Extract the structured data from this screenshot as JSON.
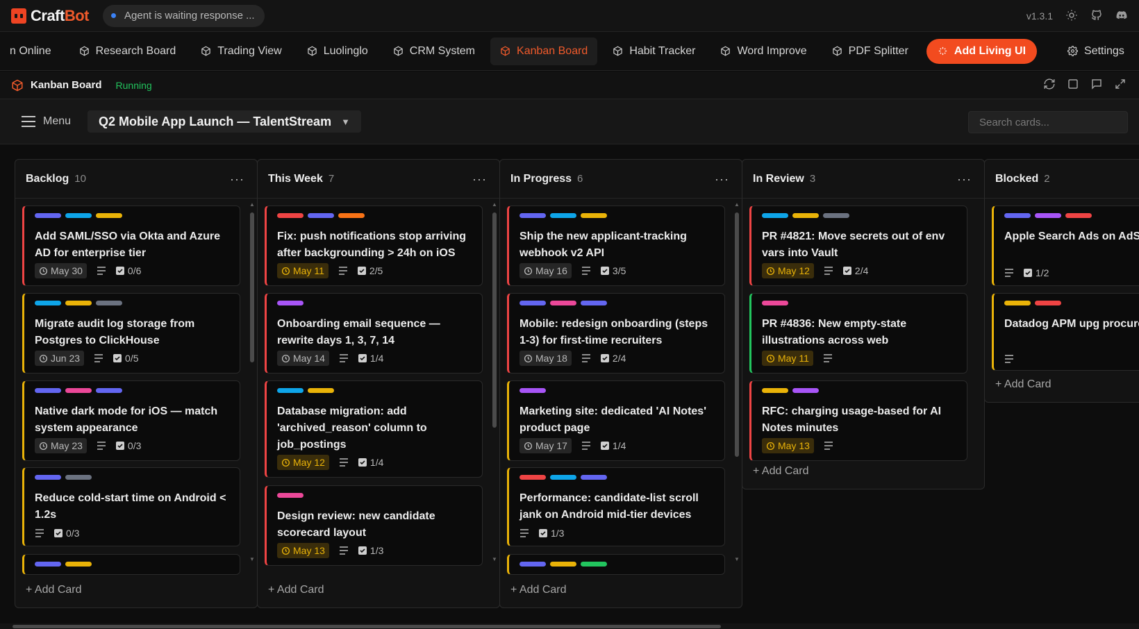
{
  "app": {
    "brand_craft": "Craft",
    "brand_bot": "Bot",
    "agent_status": "Agent is waiting response ...",
    "version": "v1.3.1"
  },
  "nav": {
    "items": [
      {
        "label": "n Online",
        "active": false,
        "icon": false
      },
      {
        "label": "Research Board",
        "active": false,
        "icon": true
      },
      {
        "label": "Trading View",
        "active": false,
        "icon": true
      },
      {
        "label": "Luolinglo",
        "active": false,
        "icon": true
      },
      {
        "label": "CRM System",
        "active": false,
        "icon": true
      },
      {
        "label": "Kanban Board",
        "active": true,
        "icon": true
      },
      {
        "label": "Habit Tracker",
        "active": false,
        "icon": true
      },
      {
        "label": "Word Improve",
        "active": false,
        "icon": true
      },
      {
        "label": "PDF Splitter",
        "active": false,
        "icon": true
      }
    ],
    "add_label": "Add Living UI",
    "settings_label": "Settings"
  },
  "appbar": {
    "title": "Kanban Board",
    "status": "Running"
  },
  "toolbar": {
    "menu_label": "Menu",
    "board_name": "Q2 Mobile App Launch — TalentStream",
    "search_placeholder": "Search cards..."
  },
  "add_card_label": "+ Add Card",
  "colors": {
    "brand": "#f05a2b",
    "tags": {
      "blue": "#3b82f6",
      "cyan": "#0ea5e9",
      "yellow": "#eab308",
      "gray": "#6b7280",
      "pink": "#ec4899",
      "indigo": "#6366f1",
      "red": "#ef4444",
      "orange": "#f97316",
      "purple": "#a855f7",
      "green": "#22c55e"
    }
  },
  "columns": [
    {
      "title": "Backlog",
      "count": "10",
      "cards": [
        {
          "tags": [
            "indigo",
            "cyan",
            "yellow"
          ],
          "title": "Add SAML/SSO via Okta and Azure AD for enterprise tier",
          "due": "May 30",
          "due_soon": false,
          "desc": true,
          "checklist": "0/6",
          "prio": "high"
        },
        {
          "tags": [
            "cyan",
            "yellow",
            "gray"
          ],
          "title": "Migrate audit log storage from Postgres to ClickHouse",
          "due": "Jun 23",
          "due_soon": false,
          "desc": true,
          "checklist": "0/5",
          "prio": "med"
        },
        {
          "tags": [
            "indigo",
            "pink",
            "indigo"
          ],
          "title": "Native dark mode for iOS — match system appearance",
          "due": "May 23",
          "due_soon": false,
          "desc": true,
          "checklist": "0/3",
          "prio": "med"
        },
        {
          "tags": [
            "indigo",
            "gray"
          ],
          "title": "Reduce cold-start time on Android < 1.2s",
          "due": "",
          "due_soon": false,
          "desc": true,
          "checklist": "0/3",
          "prio": "med"
        },
        {
          "tags": [
            "indigo",
            "yellow"
          ],
          "title": "",
          "due": "",
          "due_soon": false,
          "desc": false,
          "checklist": "",
          "prio": "med"
        }
      ]
    },
    {
      "title": "This Week",
      "count": "7",
      "cards": [
        {
          "tags": [
            "red",
            "indigo",
            "orange"
          ],
          "title": "Fix: push notifications stop arriving after backgrounding > 24h on iOS",
          "due": "May 11",
          "due_soon": true,
          "desc": true,
          "checklist": "2/5",
          "prio": "high"
        },
        {
          "tags": [
            "purple"
          ],
          "title": "Onboarding email sequence — rewrite days 1, 3, 7, 14",
          "due": "May 14",
          "due_soon": false,
          "desc": true,
          "checklist": "1/4",
          "prio": "high"
        },
        {
          "tags": [
            "cyan",
            "yellow"
          ],
          "title": "Database migration: add 'archived_reason' column to job_postings",
          "due": "May 12",
          "due_soon": true,
          "desc": true,
          "checklist": "1/4",
          "prio": "high"
        },
        {
          "tags": [
            "pink"
          ],
          "title": "Design review: new candidate scorecard layout",
          "due": "May 13",
          "due_soon": true,
          "desc": true,
          "checklist": "1/3",
          "prio": "high"
        }
      ]
    },
    {
      "title": "In Progress",
      "count": "6",
      "cards": [
        {
          "tags": [
            "indigo",
            "cyan",
            "yellow"
          ],
          "title": "Ship the new applicant-tracking webhook v2 API",
          "due": "May 16",
          "due_soon": false,
          "desc": true,
          "checklist": "3/5",
          "prio": "high"
        },
        {
          "tags": [
            "indigo",
            "pink",
            "indigo"
          ],
          "title": "Mobile: redesign onboarding (steps 1-3) for first-time recruiters",
          "due": "May 18",
          "due_soon": false,
          "desc": true,
          "checklist": "2/4",
          "prio": "high"
        },
        {
          "tags": [
            "purple"
          ],
          "title": "Marketing site: dedicated 'AI Notes' product page",
          "due": "May 17",
          "due_soon": false,
          "desc": true,
          "checklist": "1/4",
          "prio": "med"
        },
        {
          "tags": [
            "red",
            "cyan",
            "indigo"
          ],
          "title": "Performance: candidate-list scroll jank on Android mid-tier devices",
          "due": "",
          "due_soon": false,
          "desc": true,
          "checklist": "1/3",
          "prio": "med"
        },
        {
          "tags": [
            "indigo",
            "yellow",
            "green"
          ],
          "title": "",
          "due": "",
          "due_soon": false,
          "desc": false,
          "checklist": "",
          "prio": "med"
        }
      ]
    },
    {
      "title": "In Review",
      "count": "3",
      "cards": [
        {
          "tags": [
            "cyan",
            "yellow",
            "gray"
          ],
          "title": "PR #4821: Move secrets out of env vars into Vault",
          "due": "May 12",
          "due_soon": true,
          "desc": true,
          "checklist": "2/4",
          "prio": "high"
        },
        {
          "tags": [
            "pink"
          ],
          "title": "PR #4836: New empty-state illustrations across web",
          "due": "May 11",
          "due_soon": true,
          "desc": true,
          "checklist": "",
          "prio": "low"
        },
        {
          "tags": [
            "yellow",
            "purple"
          ],
          "title": "RFC: charging usage-based for AI Notes minutes",
          "due": "May 13",
          "due_soon": true,
          "desc": true,
          "checklist": "",
          "prio": "high"
        }
      ]
    },
    {
      "title": "Blocked",
      "count": "2",
      "cards": [
        {
          "tags": [
            "indigo",
            "purple",
            "red"
          ],
          "title": "Apple Search Ads on AdServices fra",
          "due": "",
          "due_soon": false,
          "desc": true,
          "checklist": "1/2",
          "prio": "med"
        },
        {
          "tags": [
            "yellow",
            "red"
          ],
          "title": "Datadog APM upg procurement",
          "due": "",
          "due_soon": false,
          "desc": true,
          "checklist": "",
          "prio": "med"
        }
      ]
    }
  ]
}
